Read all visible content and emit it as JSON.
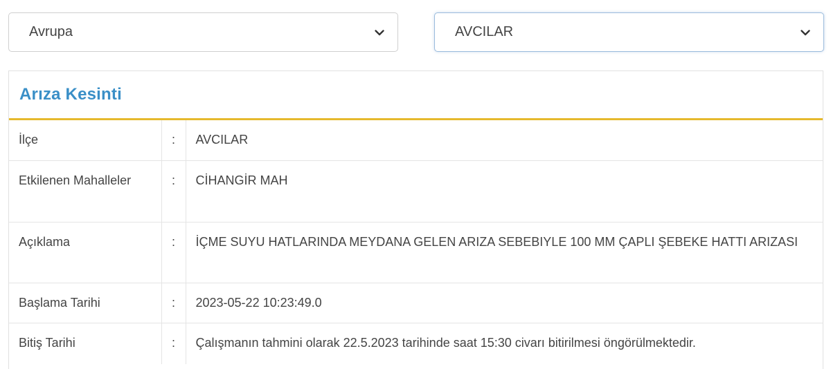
{
  "filters": {
    "region": {
      "selected": "Avrupa"
    },
    "district": {
      "selected": "AVCILAR"
    }
  },
  "panel": {
    "title": "Arıza Kesinti",
    "separator": ":",
    "rows": [
      {
        "label": "İlçe",
        "value": "AVCILAR"
      },
      {
        "label": "Etkilenen Mahalleler",
        "value": "CİHANGİR MAH"
      },
      {
        "label": "Açıklama",
        "value": "İÇME SUYU HATLARINDA MEYDANA GELEN ARIZA SEBEBIYLE 100 MM ÇAPLI ŞEBEKE HATTI ARIZASI"
      },
      {
        "label": "Başlama Tarihi",
        "value": "2023-05-22 10:23:49.0"
      },
      {
        "label": "Bitiş Tarihi",
        "value": "Çalışmanın tahmini olarak 22.5.2023 tarihinde saat 15:30 civarı bitirilmesi öngörülmektedir."
      }
    ]
  },
  "icons": {
    "dropdown": "chevron-down-icon"
  },
  "colors": {
    "title": "#3a8fc7",
    "header_rule": "#e6b92d",
    "focus_border": "#9bbcdc"
  }
}
